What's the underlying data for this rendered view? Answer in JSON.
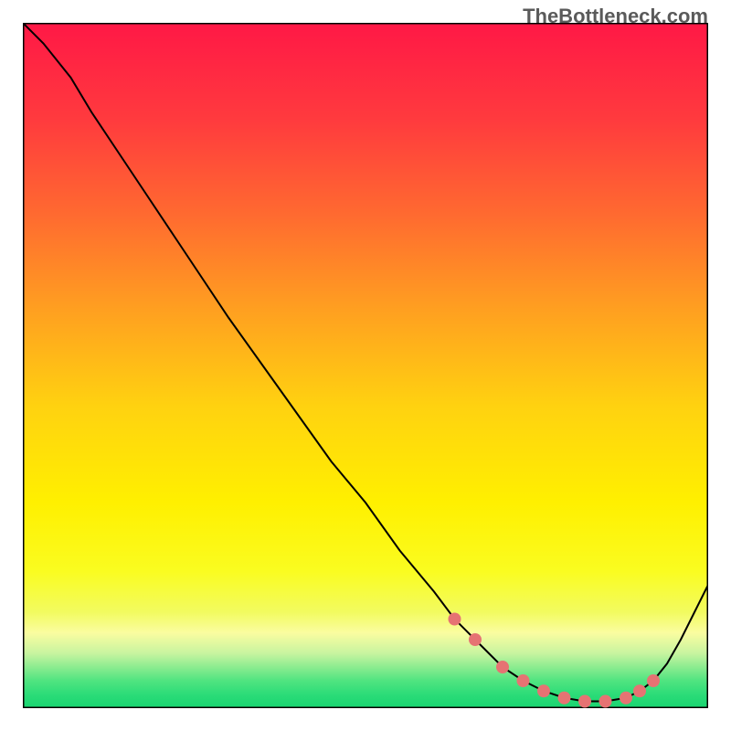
{
  "watermark": "TheBottleneck.com",
  "chart_data": {
    "type": "line",
    "title": "",
    "xlabel": "",
    "ylabel": "",
    "xlim": [
      0,
      100
    ],
    "ylim": [
      0,
      100
    ],
    "background_gradient": {
      "stops": [
        {
          "offset": 0,
          "color": "#ff1846"
        },
        {
          "offset": 14,
          "color": "#ff3a3e"
        },
        {
          "offset": 28,
          "color": "#ff6a30"
        },
        {
          "offset": 42,
          "color": "#ffa020"
        },
        {
          "offset": 56,
          "color": "#ffd210"
        },
        {
          "offset": 70,
          "color": "#fff000"
        },
        {
          "offset": 80,
          "color": "#fafc20"
        },
        {
          "offset": 86,
          "color": "#f2fb60"
        },
        {
          "offset": 89,
          "color": "#fafda0"
        },
        {
          "offset": 92,
          "color": "#c8f4a0"
        },
        {
          "offset": 94,
          "color": "#8cec90"
        },
        {
          "offset": 96,
          "color": "#50e480"
        },
        {
          "offset": 98,
          "color": "#2cdc78"
        },
        {
          "offset": 100,
          "color": "#18d470"
        }
      ]
    },
    "curve": {
      "x": [
        0,
        3,
        7,
        10,
        14,
        18,
        22,
        26,
        30,
        35,
        40,
        45,
        50,
        55,
        60,
        63,
        66,
        68,
        70,
        73,
        76,
        79,
        82,
        85,
        88,
        90,
        92,
        94,
        96,
        98,
        100
      ],
      "y": [
        100,
        97,
        92,
        87,
        81,
        75,
        69,
        63,
        57,
        50,
        43,
        36,
        30,
        23,
        17,
        13,
        10,
        8,
        6,
        4,
        2.5,
        1.5,
        1,
        1,
        1.5,
        2.5,
        4,
        6.5,
        10,
        14,
        18
      ],
      "color": "#000000",
      "width": 2
    },
    "markers": {
      "x": [
        63,
        66,
        70,
        73,
        76,
        79,
        82,
        85,
        88,
        90,
        92
      ],
      "y": [
        13,
        10,
        6,
        4,
        2.5,
        1.5,
        1,
        1,
        1.5,
        2.5,
        4
      ],
      "color": "#e67373",
      "radius": 7
    },
    "frame": {
      "color": "#000000",
      "width": 3
    }
  }
}
